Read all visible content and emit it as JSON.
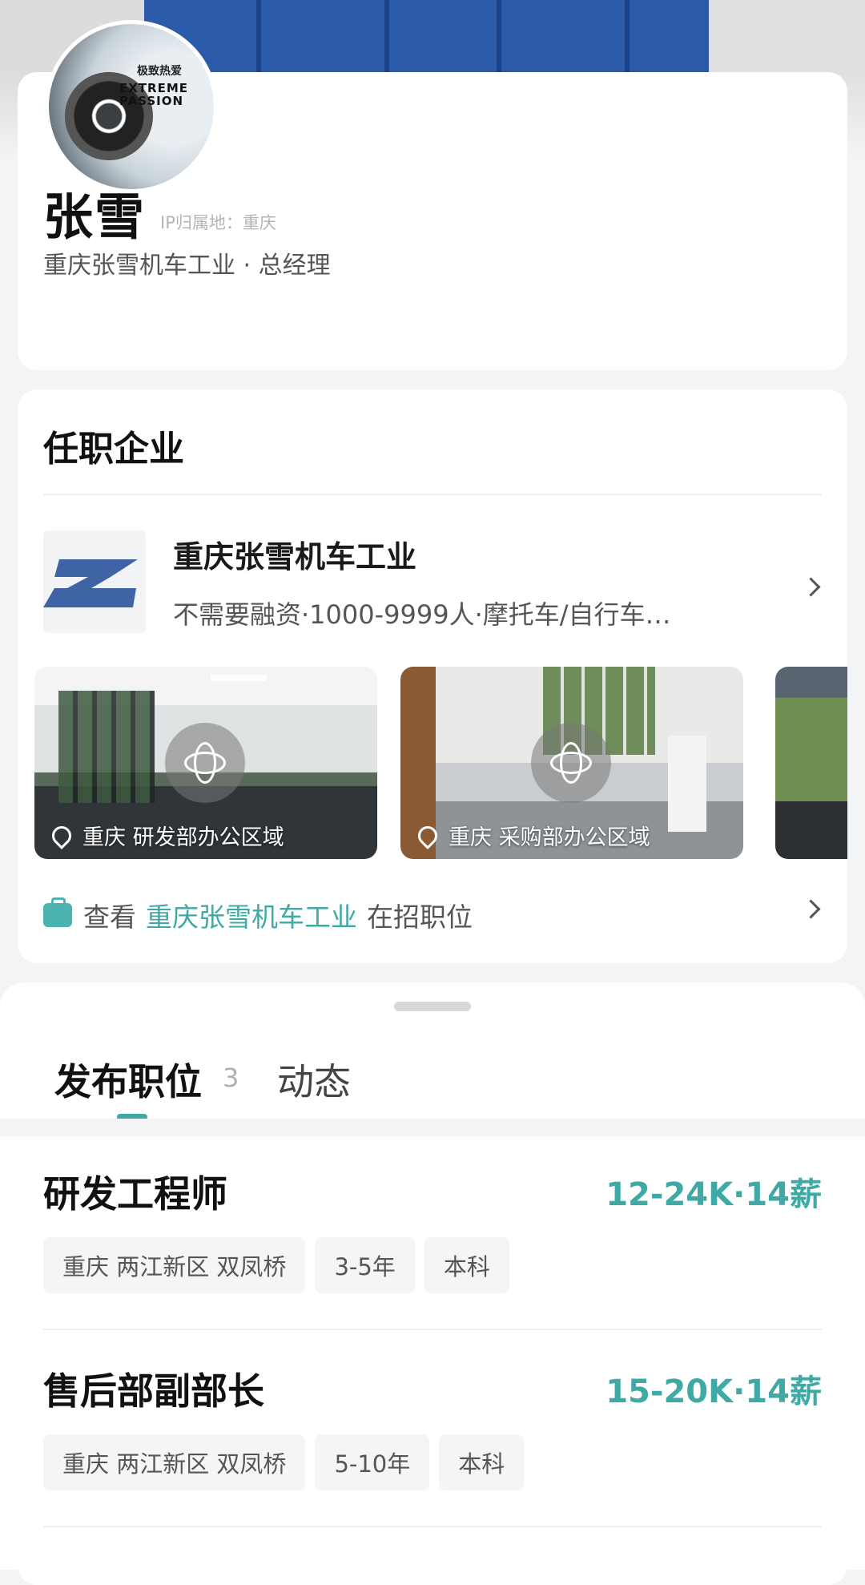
{
  "profile": {
    "avatar_text_cn": "极致热爱",
    "avatar_text_en": "EXTREME PASSION",
    "name": "张雪",
    "ip_location": "IP归属地：重庆",
    "title_line": "重庆张雪机车工业 · 总经理"
  },
  "company_section": {
    "title": "任职企业",
    "company_name": "重庆张雪机车工业",
    "company_meta": "不需要融资·1000-9999人·摩托车/自行车…",
    "photos": [
      {
        "caption": "重庆 研发部办公区域"
      },
      {
        "caption": "重庆 采购部办公区域"
      }
    ],
    "jobs_link": {
      "prefix": "查看",
      "company": "重庆张雪机车工业",
      "suffix": "在招职位"
    }
  },
  "tabs": {
    "posted_jobs": "发布职位",
    "posted_count": "3",
    "activity": "动态"
  },
  "jobs": [
    {
      "title": "研发工程师",
      "salary": "12-24K·14薪",
      "tags": [
        "重庆 两江新区 双凤桥",
        "3-5年",
        "本科"
      ]
    },
    {
      "title": "售后部副部长",
      "salary": "15-20K·14薪",
      "tags": [
        "重庆 两江新区 双凤桥",
        "5-10年",
        "本科"
      ]
    }
  ],
  "colors": {
    "accent": "#3fa9a5",
    "company_logo": "#3e64a6"
  },
  "icons": [
    "pano-360-icon",
    "location-pin-icon",
    "briefcase-icon",
    "chevron-right-icon"
  ]
}
